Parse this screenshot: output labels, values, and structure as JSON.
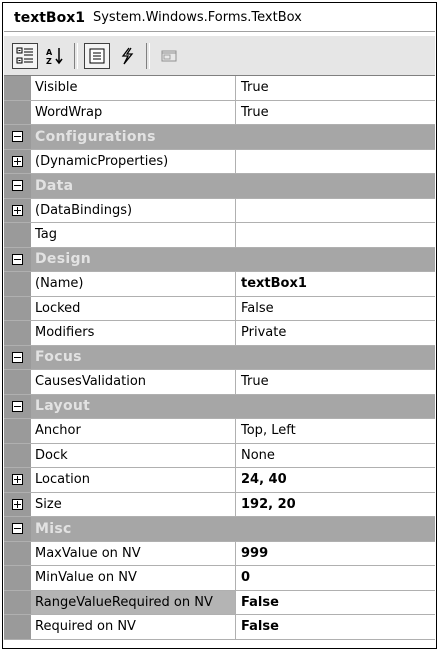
{
  "header": {
    "object_name": "textBox1",
    "object_type": "System.Windows.Forms.TextBox"
  },
  "toolbar": {
    "buttons": [
      {
        "icon": "categorized-icon",
        "pressed": true
      },
      {
        "icon": "alphabetical-icon",
        "pressed": false
      },
      {
        "icon": "properties-icon",
        "pressed": true
      },
      {
        "icon": "events-icon",
        "pressed": false
      },
      {
        "icon": "property-pages-icon",
        "pressed": false
      }
    ]
  },
  "rows": [
    {
      "type": "prop",
      "name": "Visible",
      "value": "True"
    },
    {
      "type": "prop",
      "name": "WordWrap",
      "value": "True"
    },
    {
      "type": "cat",
      "name": "Configurations"
    },
    {
      "type": "prop",
      "name": "(DynamicProperties)",
      "value": "",
      "expand": "plus"
    },
    {
      "type": "cat",
      "name": "Data"
    },
    {
      "type": "prop",
      "name": "(DataBindings)",
      "value": "",
      "expand": "plus"
    },
    {
      "type": "prop",
      "name": "Tag",
      "value": ""
    },
    {
      "type": "cat",
      "name": "Design"
    },
    {
      "type": "prop",
      "name": "(Name)",
      "value": "textBox1",
      "bold": true
    },
    {
      "type": "prop",
      "name": "Locked",
      "value": "False"
    },
    {
      "type": "prop",
      "name": "Modifiers",
      "value": "Private"
    },
    {
      "type": "cat",
      "name": "Focus"
    },
    {
      "type": "prop",
      "name": "CausesValidation",
      "value": "True"
    },
    {
      "type": "cat",
      "name": "Layout"
    },
    {
      "type": "prop",
      "name": "Anchor",
      "value": "Top, Left"
    },
    {
      "type": "prop",
      "name": "Dock",
      "value": "None"
    },
    {
      "type": "prop",
      "name": "Location",
      "value": "24, 40",
      "bold": true,
      "expand": "plus"
    },
    {
      "type": "prop",
      "name": "Size",
      "value": "192, 20",
      "bold": true,
      "expand": "plus"
    },
    {
      "type": "cat",
      "name": "Misc"
    },
    {
      "type": "prop",
      "name": "MaxValue on NV",
      "value": "999",
      "bold": true
    },
    {
      "type": "prop",
      "name": "MinValue on NV",
      "value": "0",
      "bold": true
    },
    {
      "type": "prop",
      "name": "RangeValueRequired on NV",
      "value": "False",
      "bold": true,
      "selected": true
    },
    {
      "type": "prop",
      "name": "Required on NV",
      "value": "False",
      "bold": true
    }
  ],
  "colors": {
    "category_bg": "#a6a6a6",
    "margin_bg": "#9a9a9a",
    "category_text": "#e2e2e2"
  }
}
